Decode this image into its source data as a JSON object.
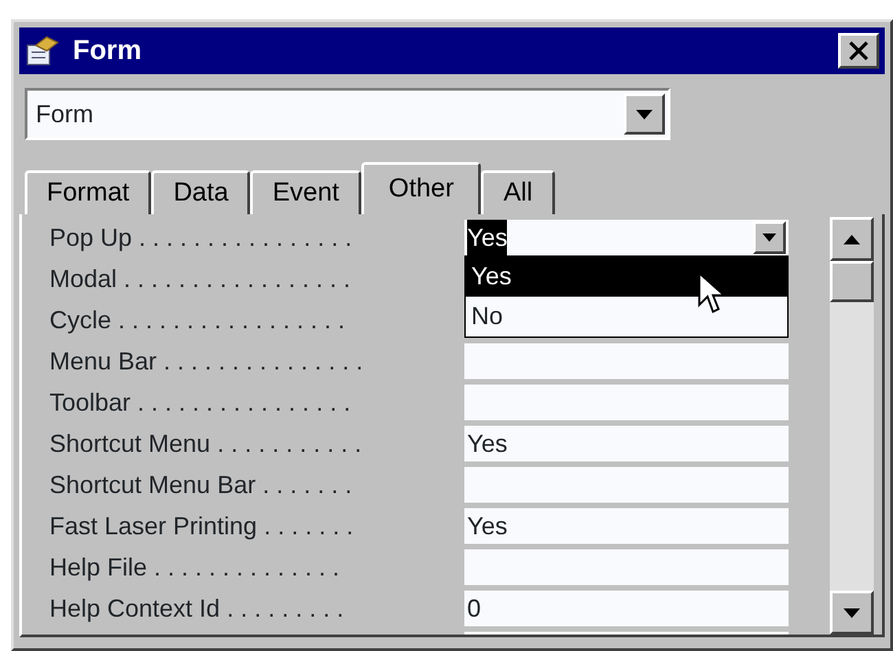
{
  "window": {
    "title": "Form"
  },
  "object_selector": {
    "value": "Form"
  },
  "tabs": [
    {
      "label": "Format",
      "selected": false
    },
    {
      "label": "Data",
      "selected": false
    },
    {
      "label": "Event",
      "selected": false
    },
    {
      "label": "Other",
      "selected": true
    },
    {
      "label": "All",
      "selected": false
    }
  ],
  "properties": [
    {
      "label": "Pop Up . . . . . . . . . . . . . . . .",
      "value": "Yes",
      "text_selected": true,
      "open": true
    },
    {
      "label": "Modal . . . . . . . . . . . . . . . . ."
    },
    {
      "label": "Cycle . . . . . . . . . . . . . . . . ."
    },
    {
      "label": "Menu Bar . . . . . . . . . . . . . . ."
    },
    {
      "label": "Toolbar . . . . . . . . . . . . . . . ."
    },
    {
      "label": "Shortcut Menu . . . . . . . . . . .",
      "value": "Yes"
    },
    {
      "label": "Shortcut Menu Bar . . . . . . ."
    },
    {
      "label": "Fast Laser Printing . . . . . . .",
      "value": "Yes"
    },
    {
      "label": "Help File . . . . . . . . . . . . . ."
    },
    {
      "label": "Help Context Id . . . . . . . . .",
      "value": "0"
    }
  ],
  "dropdown": {
    "options": [
      {
        "label": "Yes",
        "selected": true
      },
      {
        "label": "No",
        "selected": false
      }
    ]
  }
}
